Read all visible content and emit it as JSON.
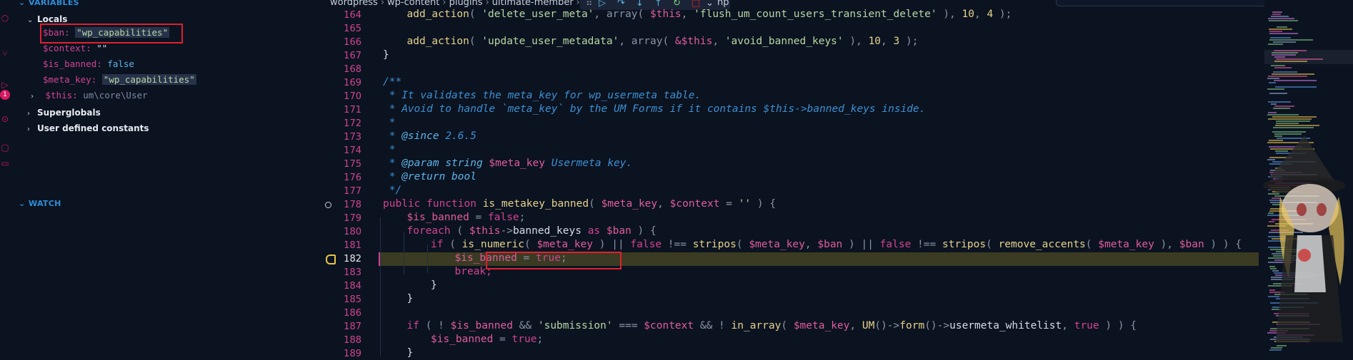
{
  "sidebar": {
    "variables_header": "VARIABLES",
    "locals_label": "Locals",
    "locals": [
      {
        "name": "$ban:",
        "value": "\"wp_capabilities\"",
        "type": "string"
      },
      {
        "name": "$context:",
        "value": "\"\"",
        "type": "string"
      },
      {
        "name": "$is_banned:",
        "value": "false",
        "type": "bool"
      },
      {
        "name": "$meta_key:",
        "value": "\"wp_capabilities\"",
        "type": "string"
      },
      {
        "name": "$this:",
        "value": "um\\core\\User",
        "type": "object"
      }
    ],
    "superglobals_label": "Superglobals",
    "user_constants_label": "User defined constants",
    "watch_header": "WATCH",
    "badge_count": "1"
  },
  "breadcrumb": [
    "wordpress",
    "wp-content",
    "plugins",
    "ultimate-member",
    "…",
    "hp"
  ],
  "debug_toolbar": {
    "icons": [
      "drag-handle",
      "continue",
      "step-over",
      "step-into",
      "step-out",
      "restart",
      "stop",
      "more"
    ]
  },
  "editor": {
    "current_line": 182,
    "lines": [
      {
        "n": "164"
      },
      {
        "n": "165"
      },
      {
        "n": "166"
      },
      {
        "n": "167"
      },
      {
        "n": "168"
      },
      {
        "n": "169"
      },
      {
        "n": "170"
      },
      {
        "n": "171"
      },
      {
        "n": "172"
      },
      {
        "n": "173"
      },
      {
        "n": "174"
      },
      {
        "n": "175"
      },
      {
        "n": "176"
      },
      {
        "n": "177"
      },
      {
        "n": "178"
      },
      {
        "n": "179"
      },
      {
        "n": "180"
      },
      {
        "n": "181"
      },
      {
        "n": "182"
      },
      {
        "n": "183"
      },
      {
        "n": "184"
      },
      {
        "n": "185"
      },
      {
        "n": "186"
      },
      {
        "n": "187"
      },
      {
        "n": "188"
      },
      {
        "n": "189"
      }
    ],
    "code": {
      "l164": [
        "add_action",
        "( ",
        "'delete_user_meta'",
        ", array( ",
        "$this",
        ", ",
        "'flush_um_count_users_transient_delete'",
        " ), ",
        "10",
        ", ",
        "4",
        " );"
      ],
      "l166": [
        "add_action",
        "( ",
        "'update_user_metadata'",
        ", array( ",
        "&$this",
        ", ",
        "'avoid_banned_keys'",
        " ), ",
        "10",
        ", ",
        "3",
        " );"
      ],
      "l167": "}",
      "l169": "/**",
      "l170": " * It validates the meta_key for wp_usermeta table.",
      "l171": " * Avoid to handle `meta_key` by the UM Forms if it contains $this->banned_keys inside.",
      "l172": " *",
      "l173": [
        " * ",
        "@since",
        " 2.6.5"
      ],
      "l174": " *",
      "l175": [
        " * ",
        "@param",
        " string",
        " $meta_key",
        " Usermeta key."
      ],
      "l176": [
        " * ",
        "@return",
        " bool"
      ],
      "l177": " */",
      "l178": [
        "public",
        " function",
        " is_metakey_banned",
        "( ",
        "$meta_key",
        ", ",
        "$context",
        " = ",
        "''",
        " ) {"
      ],
      "l179": [
        "$is_banned",
        " = ",
        "false",
        ";"
      ],
      "l180": [
        "foreach",
        " ( ",
        "$this",
        "->",
        "banned_keys",
        " as ",
        "$ban",
        " ) {"
      ],
      "l181": [
        "if",
        " ( ",
        "is_numeric",
        "( ",
        "$meta_key",
        " ) || ",
        "false",
        " !== ",
        "stripos",
        "( ",
        "$meta_key",
        ", ",
        "$ban",
        " ) || ",
        "false",
        " !== ",
        "stripos",
        "( ",
        "remove_accents",
        "( ",
        "$meta_key",
        " ), ",
        "$ban",
        " ) ) {"
      ],
      "l182": [
        "$is_banned",
        " = ",
        "true",
        ";"
      ],
      "l183": "break;",
      "l184": "}",
      "l185": "}",
      "l187": [
        "if",
        " ( ! ",
        "$is_banned",
        " && ",
        "'submission'",
        " === ",
        "$context",
        " && ! ",
        "in_array",
        "( ",
        "$meta_key",
        ", ",
        "UM",
        "()->",
        "form",
        "()->",
        "usermeta_whitelist",
        ", ",
        "true",
        " ) ) {"
      ],
      "l188": [
        "$is_banned",
        " = ",
        "true",
        ";"
      ],
      "l189": "}"
    }
  },
  "colors": {
    "accent": "#2f8fd8",
    "highlight_box": "#e0202e",
    "keyword": "#d1438f",
    "string": "#b8d7a3",
    "function": "#e6d28a",
    "comment": "#3d8fd0"
  }
}
